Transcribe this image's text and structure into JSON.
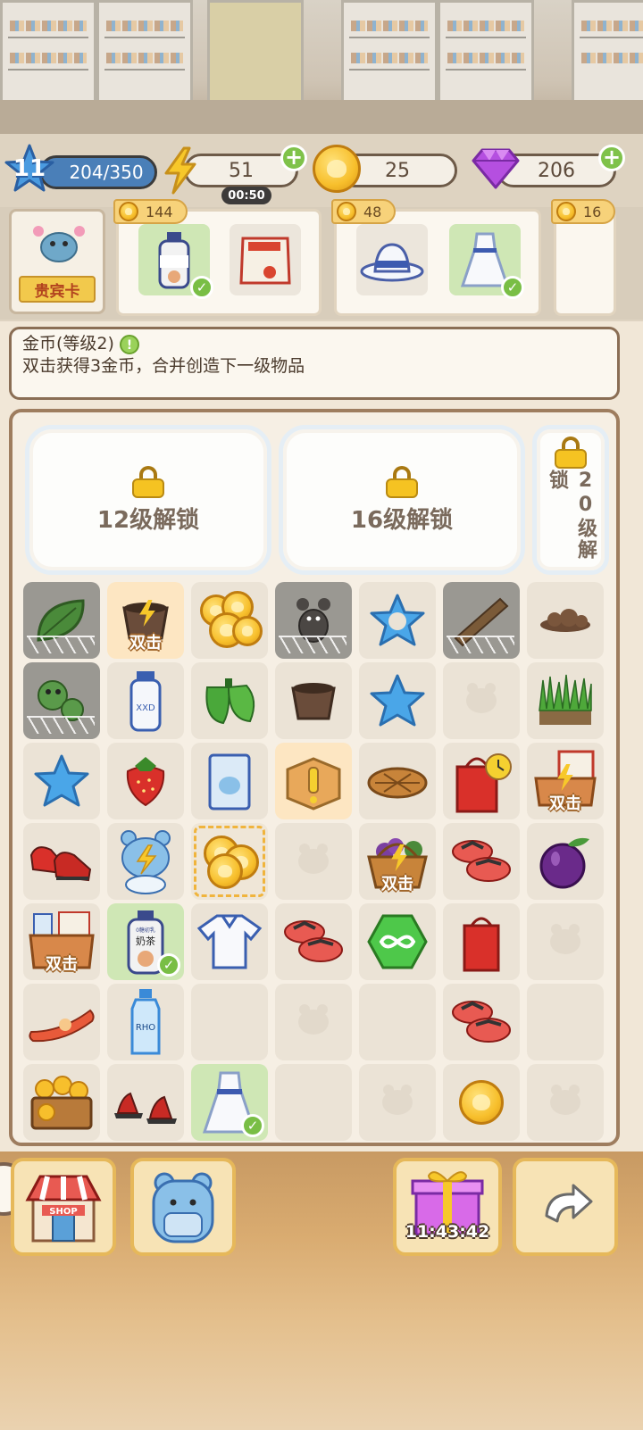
{
  "hud": {
    "level": "11",
    "xp": "204/350",
    "energy": "51",
    "energy_timer": "00:50",
    "coins": "25",
    "gems": "206",
    "colors": {
      "xp_bar": "#4a7fb8",
      "plus": "#7fc24a",
      "gem": "#b54fe0",
      "coin": "#f7bf2c"
    }
  },
  "orders": {
    "vip_label": "贵宾卡",
    "cards": [
      {
        "reward": "144",
        "items": [
          {
            "icon": "milk-tea-bottle",
            "done": true
          },
          {
            "icon": "snack-bag",
            "done": false
          }
        ]
      },
      {
        "reward": "48",
        "items": [
          {
            "icon": "white-hat",
            "done": false
          },
          {
            "icon": "white-dress",
            "done": true
          }
        ]
      },
      {
        "reward": "16",
        "items": []
      }
    ]
  },
  "info": {
    "title": "金币(等级2)",
    "description": "双击获得3金币，合并创造下一级物品"
  },
  "board": {
    "locks": [
      "12级解锁",
      "16级解锁",
      "20级解锁"
    ],
    "badge_text": "双击",
    "milk_label": "奶茶",
    "milk_sub": "0糖初乳",
    "yogurt_label": "XXD",
    "water_label": "RHO",
    "cells": [
      [
        "leaf",
        "cauldron-double-tap",
        "coin-stack",
        "rat",
        "blue-star-outline",
        "plank",
        "dirt-pile"
      ],
      [
        "caterpillar",
        "yogurt-bottle",
        "green-pepper",
        "cauldron",
        "blue-star",
        "empty",
        "grass-patch"
      ],
      [
        "blue-star",
        "strawberry",
        "milk-carton",
        "wood-crate-alert",
        "pie",
        "shopping-bag-clock",
        "snack-crate-double-tap"
      ],
      [
        "red-sneakers",
        "bear-energy",
        "coins-selected",
        "empty",
        "fruit-basket-double-tap",
        "striped-sandals",
        "plum"
      ],
      [
        "grocery-box-double-tap",
        "milk-tea-bottle-done",
        "polo-shirt",
        "striped-sandals",
        "green-infinity",
        "red-bag",
        "empty"
      ],
      [
        "sausage",
        "water-bottle",
        "empty",
        "empty",
        "empty",
        "striped-sandals",
        "empty"
      ],
      [
        "coin-chest",
        "red-sandals",
        "white-dress-done",
        "empty",
        "empty",
        "gold-coin",
        "empty"
      ]
    ]
  },
  "controls": {
    "shop_label": "SHOP",
    "gift_timer": "11:43:42"
  }
}
